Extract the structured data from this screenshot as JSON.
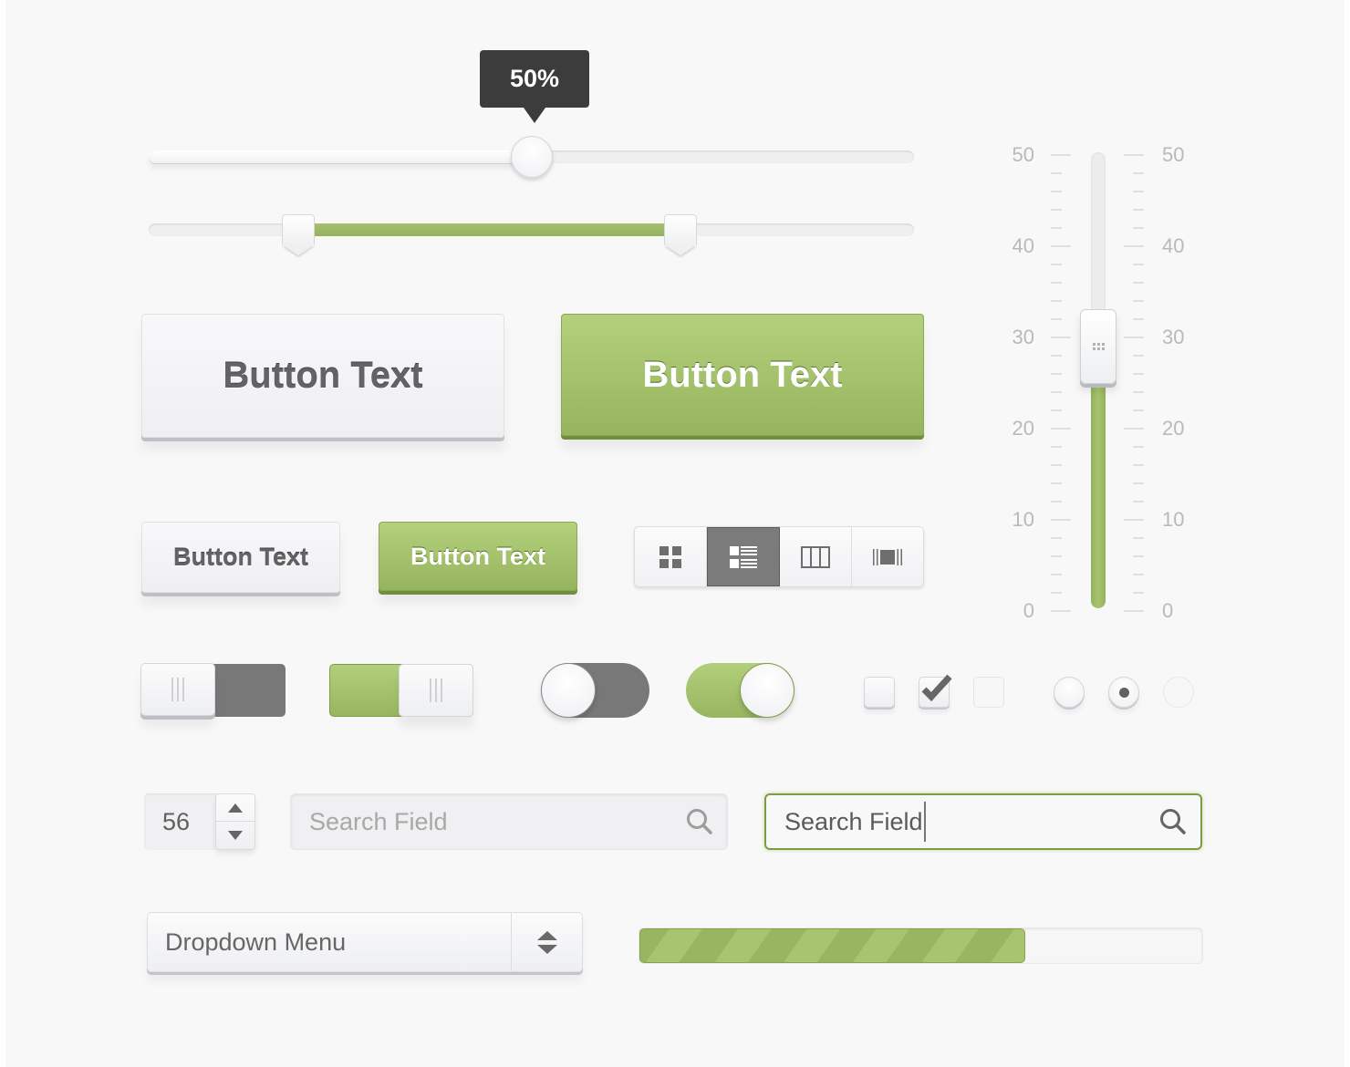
{
  "colors": {
    "accent_green": "#9ab862",
    "dark_gray": "#787878",
    "tooltip_bg": "#3c3c3c",
    "page_bg": "#f8f8f8"
  },
  "slider": {
    "value_percent": 50,
    "tooltip_text": "50%"
  },
  "range_slider": {
    "low_percent": 19.5,
    "high_percent": 69.5
  },
  "buttons": {
    "large_default_label": "Button Text",
    "large_primary_label": "Button Text",
    "small_default_label": "Button Text",
    "small_primary_label": "Button Text"
  },
  "view_switcher": {
    "selected": "list",
    "options": [
      {
        "id": "grid",
        "icon": "grid-icon"
      },
      {
        "id": "list",
        "icon": "list-icon"
      },
      {
        "id": "columns",
        "icon": "columns-icon"
      },
      {
        "id": "coverflow",
        "icon": "coverflow-icon"
      }
    ]
  },
  "vertical_slider": {
    "min": 0,
    "max": 50,
    "value": 29,
    "labels": [
      "50",
      "40",
      "30",
      "20",
      "10",
      "0"
    ]
  },
  "toggles": [
    {
      "style": "rect",
      "on": false
    },
    {
      "style": "rect",
      "on": true
    },
    {
      "style": "round",
      "on": false
    },
    {
      "style": "round",
      "on": true
    }
  ],
  "checkboxes": [
    {
      "checked": false,
      "disabled": false
    },
    {
      "checked": true,
      "disabled": false
    },
    {
      "checked": false,
      "disabled": true
    }
  ],
  "radios": [
    {
      "selected": false,
      "disabled": false
    },
    {
      "selected": true,
      "disabled": false
    },
    {
      "selected": false,
      "disabled": true
    }
  ],
  "stepper": {
    "value": "56"
  },
  "search_default": {
    "placeholder": "Search Field",
    "value": ""
  },
  "search_focused": {
    "placeholder": "Search Field",
    "value": "Search Field"
  },
  "dropdown": {
    "selected": "Dropdown Menu"
  },
  "progress": {
    "percent": 68.5
  }
}
